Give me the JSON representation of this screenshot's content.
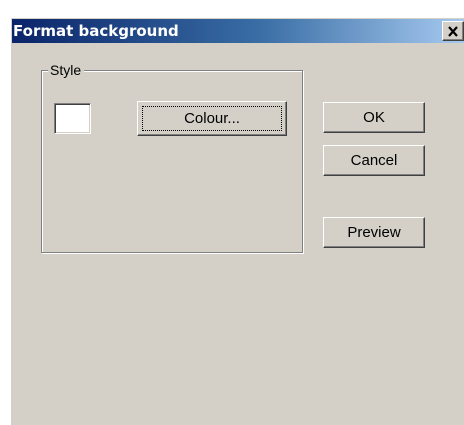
{
  "window": {
    "title": "Format background"
  },
  "style_group": {
    "label": "Style",
    "colour_button_label": "Colour...",
    "swatch_color": "#ffffff"
  },
  "buttons": {
    "ok_label": "OK",
    "cancel_label": "Cancel",
    "preview_label": "Preview"
  },
  "icons": {
    "close": "close-icon"
  }
}
